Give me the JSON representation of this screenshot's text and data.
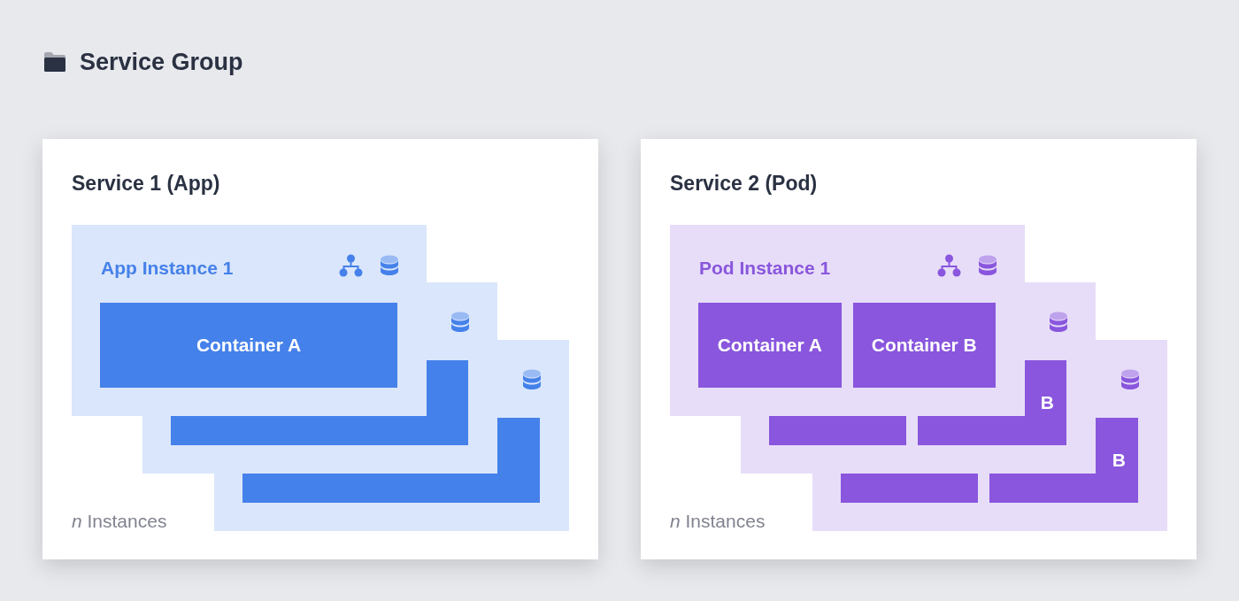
{
  "heading": {
    "title": "Service Group"
  },
  "services": [
    {
      "title": "Service 1 (App)",
      "color": "#4581ea",
      "footer": "*n* Instances",
      "instances": [
        {
          "title": "App Instance 1",
          "icons": [
            {
              "kind": "network"
            },
            {
              "kind": "database"
            }
          ],
          "containers": [
            {
              "kind": "labeled",
              "label": "Container A"
            }
          ]
        },
        {
          "icons": [
            {
              "kind": "database"
            }
          ],
          "containers": [
            {
              "kind": "blank"
            }
          ]
        },
        {
          "icons": [
            {
              "kind": "database"
            }
          ],
          "containers": [
            {
              "kind": "blank"
            }
          ]
        }
      ]
    },
    {
      "title": "Service 2 (Pod)",
      "color": "#8956dd",
      "footer": "*n* Instances",
      "instances": [
        {
          "title": "Pod Instance 1",
          "icons": [
            {
              "kind": "network"
            },
            {
              "kind": "database"
            }
          ],
          "containers": [
            {
              "kind": "labeled",
              "label": "Container A"
            },
            {
              "kind": "labeled",
              "label": "Container B"
            }
          ]
        },
        {
          "icons": [
            {
              "kind": "database"
            }
          ],
          "containers": [
            {
              "kind": "blank"
            },
            {
              "kind": "labeled",
              "label": "B"
            }
          ]
        },
        {
          "icons": [
            {
              "kind": "database"
            }
          ],
          "containers": [
            {
              "kind": "blank"
            },
            {
              "kind": "labeled",
              "label": "B"
            }
          ]
        }
      ]
    }
  ]
}
